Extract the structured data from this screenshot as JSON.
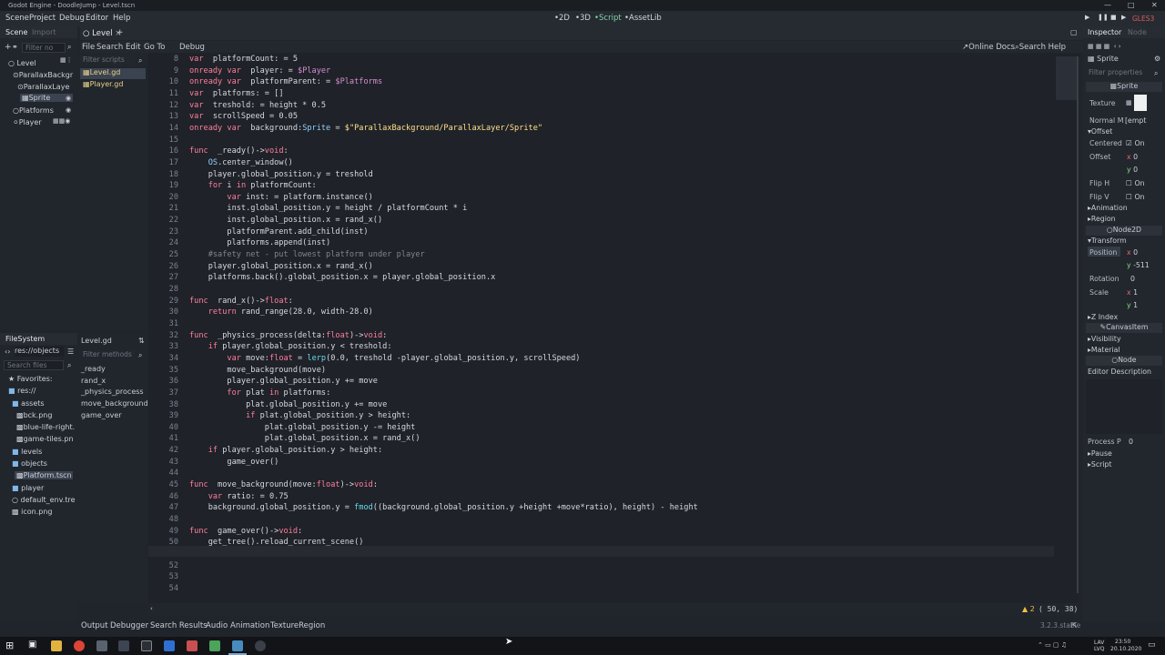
{
  "window": {
    "title": "Godot Engine - DoodleJump - Level.tscn"
  },
  "menu": {
    "items": [
      "Scene",
      "Project",
      "Debug",
      "Editor",
      "Help"
    ]
  },
  "modes": {
    "m2d": "2D",
    "m3d": "3D",
    "script": "Script",
    "assetlib": "AssetLib"
  },
  "renderer": "GLES3",
  "scene_dock": {
    "tabs": {
      "scene": "Scene",
      "import": "Import"
    },
    "filter_placeholder": "Filter no",
    "nodes": [
      "Level",
      "ParallaxBackgr",
      "ParallaxLaye",
      "Sprite",
      "Platforms",
      "Player"
    ]
  },
  "filesystem_dock": {
    "title": "FileSystem",
    "path": "res://objects",
    "search_placeholder": "Search files",
    "items": [
      "Favorites:",
      "res://",
      "assets",
      "bck.png",
      "blue-life-right.",
      "game-tiles.pn",
      "levels",
      "objects",
      "Platform.tscn",
      "player",
      "default_env.tre",
      "icon.png"
    ]
  },
  "script_editor": {
    "tab": "Level",
    "menu": [
      "File",
      "Search",
      "Edit",
      "Go To",
      "Debug"
    ],
    "online_docs": "Online Docs",
    "search_help": "Search Help",
    "filter_scripts": "Filter scripts",
    "scripts": [
      "Level.gd",
      "Player.gd"
    ],
    "current_script": "Level.gd",
    "filter_methods": "Filter methods",
    "methods": [
      "_ready",
      "rand_x",
      "_physics_process",
      "move_background",
      "game_over"
    ],
    "line_numbers": [
      "8",
      "9",
      "10",
      "11",
      "12",
      "13",
      "14",
      "15",
      "16",
      "17",
      "18",
      "19",
      "20",
      "21",
      "22",
      "23",
      "24",
      "25",
      "26",
      "27",
      "28",
      "29",
      "30",
      "31",
      "32",
      "33",
      "34",
      "35",
      "36",
      "37",
      "38",
      "39",
      "40",
      "41",
      "42",
      "43",
      "44",
      "45",
      "46",
      "47",
      "48",
      "49",
      "50",
      "51",
      "52",
      "53",
      "54"
    ],
    "warnings": "2",
    "cursor": "( 50, 38)"
  },
  "bottom_panel": {
    "tabs": [
      "Output",
      "Debugger",
      "Search Results",
      "Audio",
      "Animation",
      "TextureRegion"
    ],
    "version": "3.2.3.stable"
  },
  "inspector": {
    "tabs": {
      "inspector": "Inspector",
      "node": "Node"
    },
    "object": "Sprite",
    "filter_placeholder": "Filter properties",
    "class_label": "Sprite",
    "texture_label": "Texture",
    "normal_map_label": "Normal M",
    "normal_map_value": "[empt",
    "offset_section": "Offset",
    "centered_label": "Centered",
    "on_label": "On",
    "offset_label": "Offset",
    "offset_x": "0",
    "offset_y": "0",
    "flip_h_label": "Flip H",
    "flip_v_label": "Flip V",
    "animation_section": "Animation",
    "region_section": "Region",
    "node2d_class": "Node2D",
    "transform_section": "Transform",
    "position_label": "Position",
    "position_x": "0",
    "position_y": "-511",
    "rotation_label": "Rotation",
    "rotation_value": "0",
    "scale_label": "Scale",
    "scale_x": "1",
    "scale_y": "1",
    "zindex_section": "Z Index",
    "canvasitem_class": "CanvasItem",
    "visibility_section": "Visibility",
    "material_section": "Material",
    "node_class": "Node",
    "editor_description": "Editor Description",
    "process_priority_label": "Process P",
    "process_priority_value": "0",
    "pause_section": "Pause",
    "script_section": "Script"
  },
  "taskbar": {
    "lang": "LAV\nLVQ",
    "time": "23:50",
    "date": "20.10.2020"
  }
}
